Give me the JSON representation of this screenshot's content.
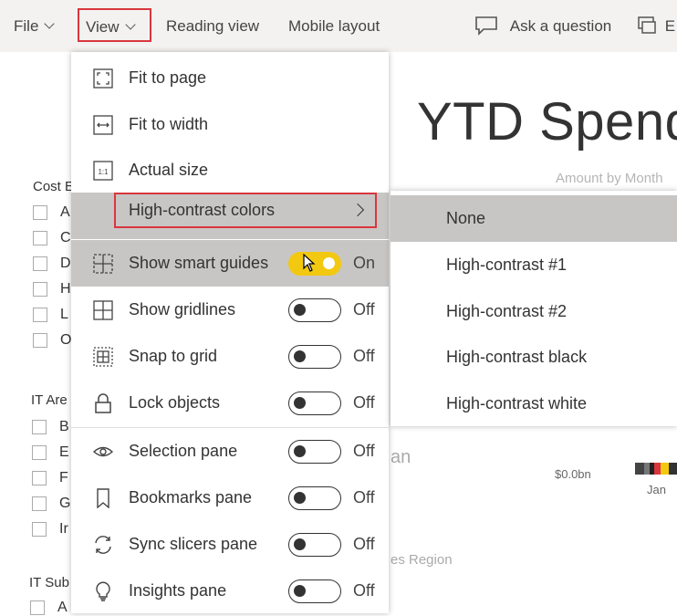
{
  "menubar": {
    "file": "File",
    "view": "View",
    "reading_view": "Reading view",
    "mobile_layout": "Mobile layout",
    "ask_question": "Ask a question",
    "partial": "E"
  },
  "report": {
    "title": "YTD Spend",
    "subtitle": "Amount by Month",
    "cost_label": "Cost E",
    "cost_letters": [
      "A",
      "C",
      "D",
      "H",
      "L",
      "O"
    ],
    "it_area_label": "IT Are",
    "it_area_letters": [
      "B",
      "E",
      "F",
      "G",
      "Ir"
    ],
    "it_sub_label": "IT Sub",
    "it_sub_letters": [
      "A"
    ],
    "frag_an": "an",
    "frag_region": "es Region",
    "axis_value": "$0.0bn",
    "axis_month": "Jan"
  },
  "view_menu": {
    "items": [
      {
        "label": "Fit to page",
        "icon": "fit-to-page-icon"
      },
      {
        "label": "Fit to width",
        "icon": "fit-to-width-icon"
      },
      {
        "label": "Actual size",
        "icon": "actual-size-icon"
      }
    ],
    "high_contrast": "High-contrast colors",
    "toggles": [
      {
        "label": "Show smart guides",
        "icon": "smart-guides-icon",
        "state": "On"
      },
      {
        "label": "Show gridlines",
        "icon": "gridlines-icon",
        "state": "Off"
      },
      {
        "label": "Snap to grid",
        "icon": "snap-to-grid-icon",
        "state": "Off"
      },
      {
        "label": "Lock objects",
        "icon": "lock-icon",
        "state": "Off"
      },
      {
        "label": "Selection pane",
        "icon": "eye-icon",
        "state": "Off"
      },
      {
        "label": "Bookmarks pane",
        "icon": "bookmark-icon",
        "state": "Off"
      },
      {
        "label": "Sync slicers pane",
        "icon": "sync-icon",
        "state": "Off"
      },
      {
        "label": "Insights pane",
        "icon": "lightbulb-icon",
        "state": "Off"
      }
    ]
  },
  "contrast_submenu": {
    "options": [
      "None",
      "High-contrast #1",
      "High-contrast #2",
      "High-contrast black",
      "High-contrast white"
    ],
    "selected": "None"
  },
  "colors": {
    "accent_highlight": "#d9363e",
    "toggle_on": "#f2c811",
    "hover": "#c8c6c4"
  }
}
